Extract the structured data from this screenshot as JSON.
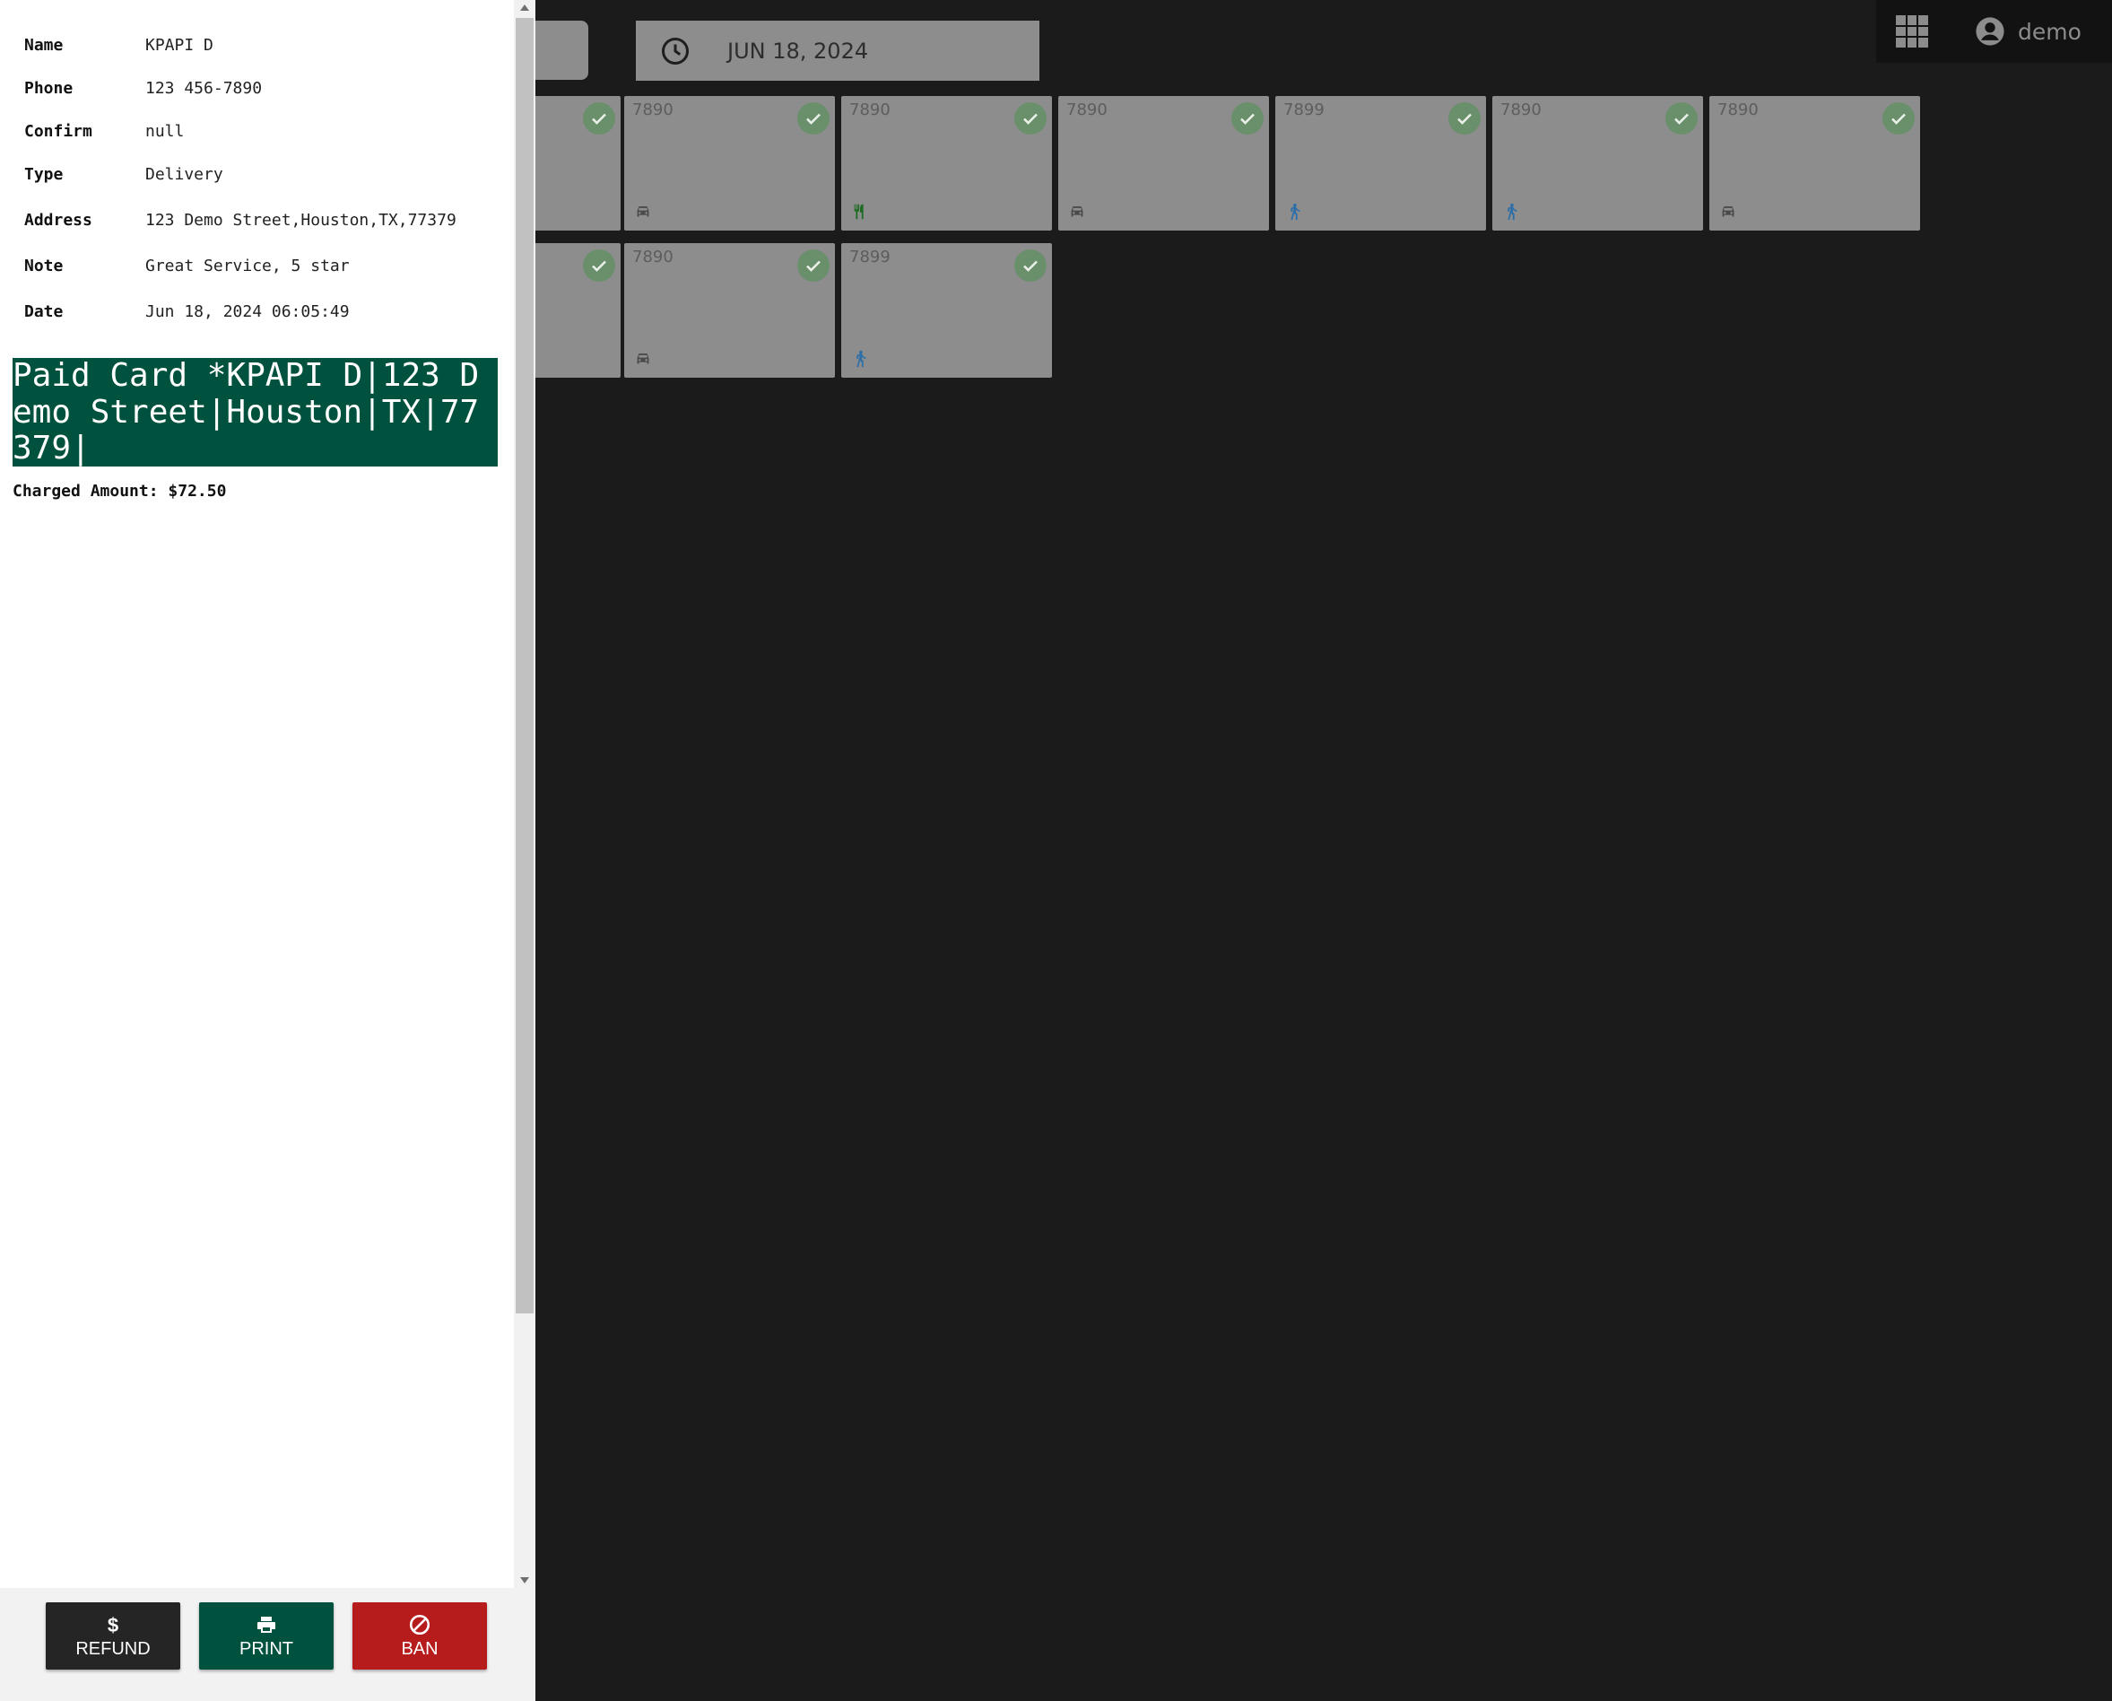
{
  "header": {
    "date": "JUN 18, 2024",
    "user": "demo",
    "icons": [
      "clock-icon",
      "apps-grid-icon",
      "account-circle-icon"
    ]
  },
  "orders": {
    "row1": [
      {
        "num": "",
        "type": "car"
      },
      {
        "num": "7890",
        "type": "car"
      },
      {
        "num": "7890",
        "type": "dine-in"
      },
      {
        "num": "7890",
        "type": "car"
      },
      {
        "num": "7899",
        "type": "walk"
      },
      {
        "num": "7890",
        "type": "walk"
      },
      {
        "num": "7890",
        "type": "car"
      }
    ],
    "row2": [
      {
        "num": "",
        "type": "none"
      },
      {
        "num": "7890",
        "type": "car"
      },
      {
        "num": "7899",
        "type": "walk"
      }
    ]
  },
  "details": {
    "name_label": "Name",
    "name": "KPAPI D",
    "phone_label": "Phone",
    "phone": "123 456-7890",
    "confirm_label": "Confirm",
    "confirm": "null",
    "type_label": "Type",
    "type": "Delivery",
    "address_label": "Address",
    "address": "123 Demo Street,Houston,TX,77379",
    "note_label": "Note",
    "note": "Great Service, 5 star",
    "date_label": "Date",
    "date": "Jun 18, 2024 06:05:49"
  },
  "receipt": {
    "text": "Paid Card *KPAPI D|123 Demo Street|Houston|TX|77379|",
    "charged": "Charged Amount: $72.50"
  },
  "actions": {
    "refund": "REFUND",
    "print": "PRINT",
    "ban": "BAN"
  },
  "colors": {
    "brand_green": "#01513f",
    "danger_red": "#b71c1c",
    "dark": "#252525",
    "check_green": "#6a8f6b"
  }
}
